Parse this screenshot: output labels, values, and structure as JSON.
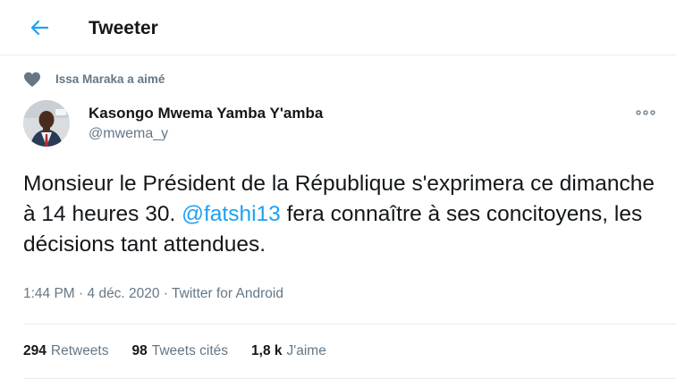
{
  "header": {
    "title": "Tweeter"
  },
  "social_context": {
    "text": "Issa Maraka a aimé"
  },
  "tweet": {
    "author_name": "Kasongo Mwema Yamba Y'amba",
    "author_handle": "@mwema_y",
    "text_before": "Monsieur le Président de la République s'exprimera ce dimanche à 14 heures 30. ",
    "mention": "@fatshi13",
    "text_after": " fera connaître à ses concitoyens, les décisions tant attendues.",
    "time": "1:44 PM",
    "separator": " · ",
    "date": "4 déc. 2020",
    "source": "Twitter for Android"
  },
  "stats": {
    "retweets_count": "294",
    "retweets_label": "Retweets",
    "quotes_count": "98",
    "quotes_label": "Tweets cités",
    "likes_count": "1,8 k",
    "likes_label": "J'aime"
  },
  "colors": {
    "accent": "#1da1f2",
    "secondary_text": "#657786",
    "primary_text": "#14171a",
    "border": "#e6ecf0"
  },
  "icons": {
    "back": "arrow-left-icon",
    "liked": "heart-icon",
    "more": "more-dots-icon"
  }
}
